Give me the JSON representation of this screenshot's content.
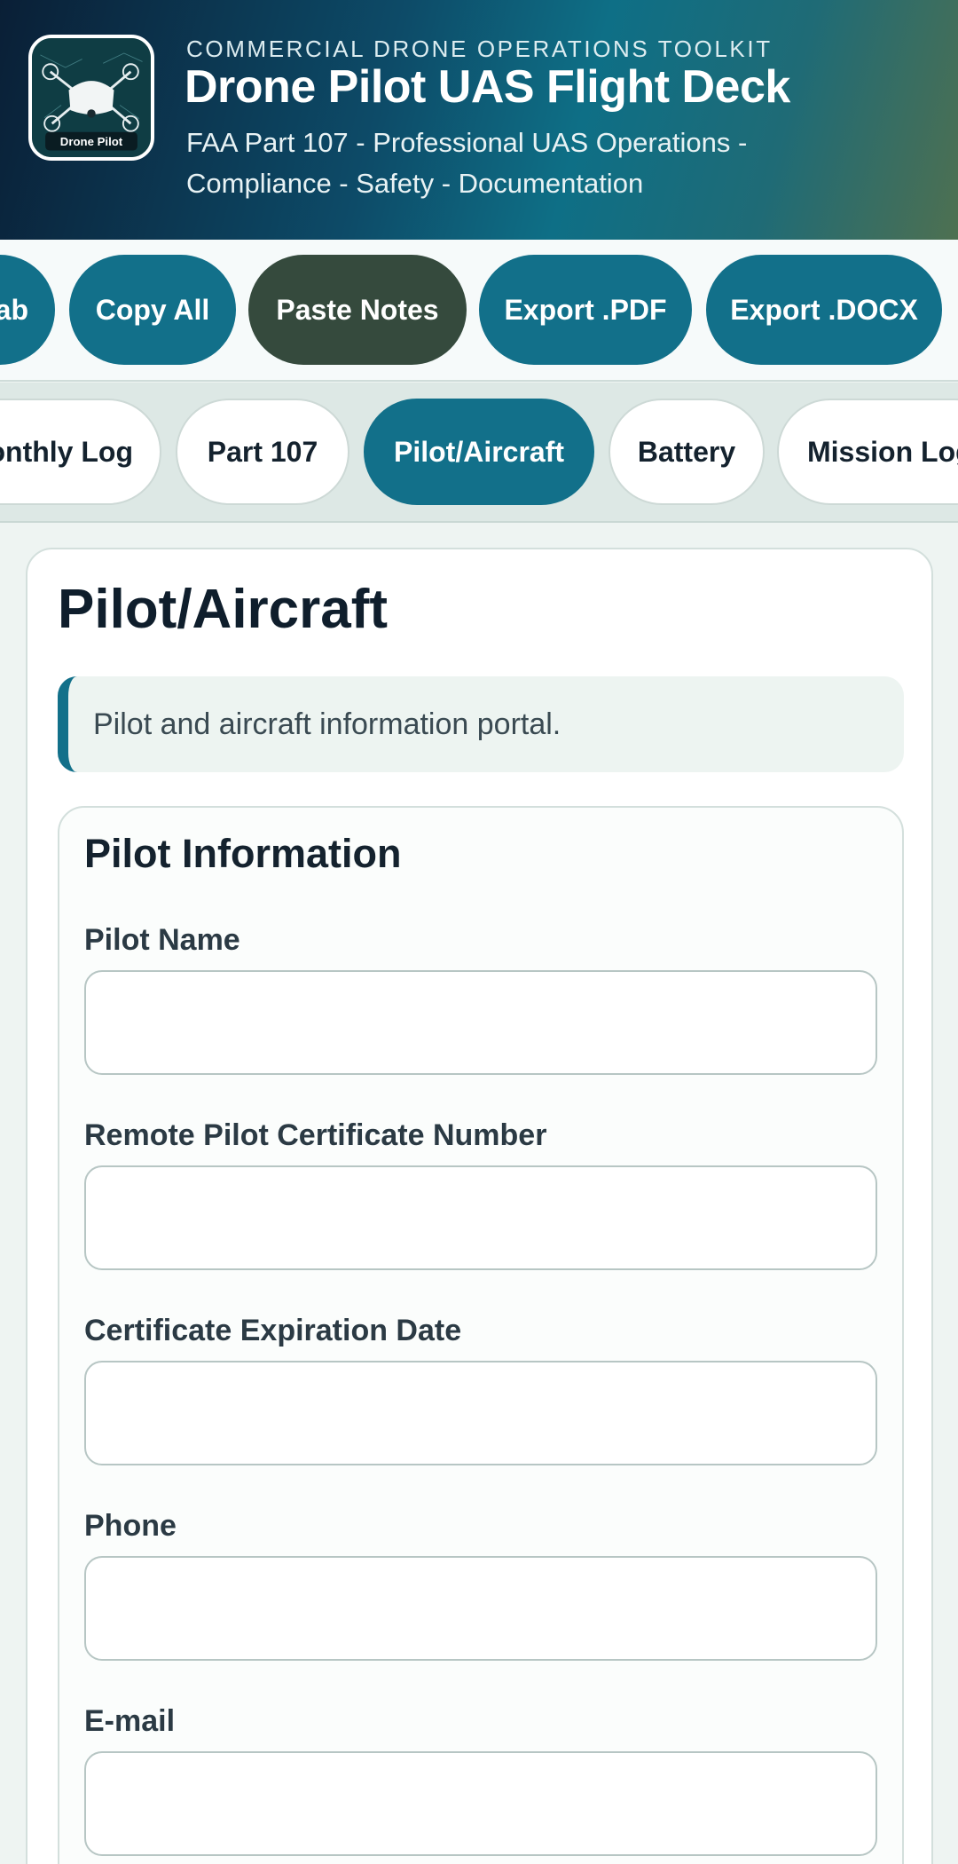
{
  "header": {
    "eyebrow": "COMMERCIAL DRONE OPERATIONS TOOLKIT",
    "title": "Drone Pilot UAS Flight Deck",
    "subtitle_line1": "FAA Part 107 - Professional UAS Operations -",
    "subtitle_line2": "Compliance - Safety - Documentation",
    "logo_text": "Drone Pilot",
    "logo_icon": "drone-icon"
  },
  "toolbar": {
    "buttons": [
      {
        "label": "ab"
      },
      {
        "label": "Copy All"
      },
      {
        "label": "Paste Notes"
      },
      {
        "label": "Export .PDF"
      },
      {
        "label": "Export .DOCX"
      }
    ]
  },
  "tabs": {
    "items": [
      {
        "label": "onthly Log"
      },
      {
        "label": "Part 107"
      },
      {
        "label": "Pilot/Aircraft",
        "active": true
      },
      {
        "label": "Battery"
      },
      {
        "label": "Mission Log"
      }
    ]
  },
  "page": {
    "title": "Pilot/Aircraft",
    "notice": "Pilot and aircraft information portal."
  },
  "section": {
    "title": "Pilot Information",
    "fields": [
      {
        "label": "Pilot Name",
        "value": ""
      },
      {
        "label": "Remote Pilot Certificate Number",
        "value": ""
      },
      {
        "label": "Certificate Expiration Date",
        "value": ""
      },
      {
        "label": "Phone",
        "value": ""
      },
      {
        "label": "E-mail",
        "value": ""
      }
    ]
  },
  "colors": {
    "accent": "#12708a",
    "dark_button": "#354a3d",
    "header_start": "#0a1f36",
    "header_end": "#4e7051"
  }
}
